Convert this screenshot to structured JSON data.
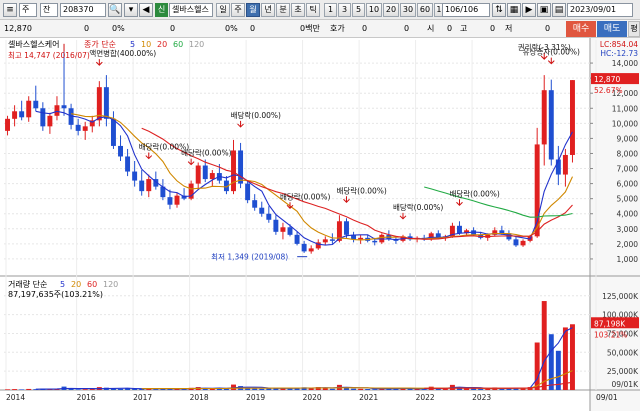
{
  "toolbar": {
    "market_toggle": "주",
    "search_toggle": "잔",
    "stock_code": "208370",
    "stock_badge": "신",
    "stock_name": "셀바스헬스",
    "period_buttons": [
      "일",
      "주",
      "월",
      "년",
      "분",
      "초",
      "틱"
    ],
    "selected_period": "월",
    "interval_buttons": [
      "1",
      "3",
      "5",
      "10",
      "20",
      "30",
      "60",
      "120"
    ],
    "range_display": "106/106",
    "date_display": "2023/09/01"
  },
  "quote_bar": {
    "price": "12,870",
    "change": "0",
    "change_pct": "0%",
    "v1": "0",
    "v2": "0%",
    "v3": "0",
    "vol_label": "0백만",
    "hoga_label": "호가",
    "h1": "0",
    "h2": "0",
    "si_label": "시",
    "si": "0",
    "go_label": "고",
    "go": "0",
    "jeo_label": "저",
    "jeo": "0",
    "buy_label": "매수",
    "sell_label": "매도",
    "eval_label": "평"
  },
  "price_panel": {
    "title": "셀바스헬스케어",
    "title2": "종가 단순",
    "ma_periods": [
      "5",
      "10",
      "20",
      "60",
      "120"
    ],
    "ma_colors": [
      "#2233cc",
      "#d08800",
      "#dd2222",
      "#22aa44",
      "#999999"
    ],
    "lc_label": "LC:854.04",
    "hc_label": "HC:-12.73",
    "high_annotation": "최고 14,747 (2016/07)",
    "low_annotation": "최저 1,349 (2019/08)",
    "price_tag": "12,870",
    "pct_tag": "52.67%",
    "y_ticks": [
      "14,000",
      "13,000",
      "12,000",
      "11,000",
      "10,000",
      "9,000",
      "8,000",
      "7,000",
      "6,000",
      "5,000",
      "4,000",
      "3,000",
      "2,000",
      "1,000"
    ],
    "events": [
      {
        "label": "액면병합(400.00%)"
      },
      {
        "label": "배당락(0.00%)"
      },
      {
        "label": "배당락(0.00%)"
      },
      {
        "label": "배당락(0.00%)"
      },
      {
        "label": "배당락(0.00%)"
      },
      {
        "label": "배당락(0.00%)"
      },
      {
        "label": "배당락(0.00%)"
      },
      {
        "label": "배당락(0.00%)"
      },
      {
        "label": "권리락(-3.31%)"
      },
      {
        "label": "유상증자(0.00%)"
      }
    ]
  },
  "volume_panel": {
    "title": "거래량 단순",
    "ma_periods": [
      "5",
      "20",
      "60",
      "120"
    ],
    "ma_colors": [
      "#2233cc",
      "#d08800",
      "#dd2222",
      "#999999"
    ],
    "volume_text": "87,197,635주(103.21%)",
    "y_ticks": [
      "125,000K",
      "100,000K",
      "75,000K",
      "50,000K",
      "25,000K"
    ],
    "unit_label": "09/01K",
    "volume_tag": "87,198K",
    "pct_tag": "103.21%"
  },
  "x_axis": [
    "2014",
    "2016",
    "2017",
    "2018",
    "2019",
    "2020",
    "2021",
    "2022",
    "2023",
    "09/01"
  ],
  "chart_data": [
    {
      "type": "candlestick",
      "title": "셀바스헬스케어",
      "ylim": [
        0,
        15000
      ],
      "highlights": {
        "high": 14747,
        "high_date": "2016/07",
        "low": 1349,
        "low_date": "2019/08",
        "last": 12870
      },
      "x_labels": [
        "2014",
        "2016",
        "2017",
        "2018",
        "2019",
        "2020",
        "2021",
        "2022",
        "2023"
      ],
      "candles": [
        [
          9500,
          10500,
          9200,
          10300
        ],
        [
          10300,
          11200,
          9800,
          10800
        ],
        [
          10800,
          11500,
          10200,
          10400
        ],
        [
          10400,
          11800,
          10100,
          11500
        ],
        [
          11500,
          12500,
          10800,
          11000
        ],
        [
          11000,
          11400,
          9500,
          9800
        ],
        [
          9800,
          10700,
          9300,
          10500
        ],
        [
          10500,
          11800,
          10200,
          11200
        ],
        [
          11200,
          14747,
          10500,
          11000
        ],
        [
          11000,
          11300,
          9600,
          9900
        ],
        [
          9900,
          10300,
          9200,
          9500
        ],
        [
          9500,
          10100,
          8900,
          9800
        ],
        [
          9800,
          10500,
          9400,
          10200
        ],
        [
          10200,
          12800,
          9800,
          12400
        ],
        [
          12400,
          13200,
          9800,
          10300
        ],
        [
          10300,
          10800,
          8300,
          8500
        ],
        [
          8500,
          9200,
          7500,
          7800
        ],
        [
          7800,
          8300,
          6500,
          6800
        ],
        [
          6800,
          7500,
          5800,
          6200
        ],
        [
          6200,
          6900,
          5200,
          5500
        ],
        [
          5500,
          6600,
          5100,
          6300
        ],
        [
          6300,
          6800,
          5600,
          5800
        ],
        [
          5800,
          6300,
          4900,
          5100
        ],
        [
          5100,
          5600,
          4300,
          4600
        ],
        [
          4600,
          5400,
          4400,
          5200
        ],
        [
          5200,
          5700,
          4900,
          5000
        ],
        [
          5000,
          6200,
          4900,
          6000
        ],
        [
          6000,
          7400,
          5600,
          7200
        ],
        [
          7200,
          7600,
          6100,
          6300
        ],
        [
          6300,
          6900,
          5800,
          6700
        ],
        [
          6700,
          7300,
          6000,
          6200
        ],
        [
          6200,
          6500,
          5300,
          5500
        ],
        [
          5500,
          8900,
          5300,
          8200
        ],
        [
          8200,
          8700,
          5700,
          6000
        ],
        [
          6000,
          6200,
          4700,
          4900
        ],
        [
          4900,
          5300,
          4200,
          4400
        ],
        [
          4400,
          4800,
          3800,
          4000
        ],
        [
          4000,
          4500,
          3400,
          3600
        ],
        [
          3600,
          3900,
          2600,
          2800
        ],
        [
          2800,
          3400,
          2300,
          3100
        ],
        [
          3100,
          3300,
          2500,
          2600
        ],
        [
          2600,
          2800,
          1900,
          2000
        ],
        [
          2000,
          2200,
          1400,
          1500
        ],
        [
          1500,
          1900,
          1349,
          1700
        ],
        [
          1700,
          2300,
          1600,
          2100
        ],
        [
          2100,
          2500,
          1900,
          2300
        ],
        [
          2300,
          2700,
          2000,
          2200
        ],
        [
          2200,
          3900,
          2100,
          3500
        ],
        [
          3500,
          3700,
          2400,
          2600
        ],
        [
          2600,
          2800,
          2100,
          2300
        ],
        [
          2300,
          2600,
          2000,
          2400
        ],
        [
          2400,
          2600,
          2100,
          2200
        ],
        [
          2200,
          2400,
          1900,
          2100
        ],
        [
          2100,
          2700,
          2000,
          2600
        ],
        [
          2600,
          2900,
          2200,
          2300
        ],
        [
          2300,
          2500,
          2000,
          2200
        ],
        [
          2200,
          2600,
          2100,
          2500
        ],
        [
          2500,
          2700,
          2200,
          2300
        ],
        [
          2300,
          2500,
          2100,
          2400
        ],
        [
          2400,
          2600,
          2200,
          2300
        ],
        [
          2300,
          2800,
          2200,
          2700
        ],
        [
          2700,
          2900,
          2300,
          2400
        ],
        [
          2400,
          2600,
          2200,
          2500
        ],
        [
          2500,
          3400,
          2400,
          3200
        ],
        [
          3200,
          3500,
          2600,
          2700
        ],
        [
          2700,
          3000,
          2500,
          2900
        ],
        [
          2900,
          3100,
          2500,
          2600
        ],
        [
          2600,
          2800,
          2300,
          2400
        ],
        [
          2400,
          2700,
          2200,
          2600
        ],
        [
          2600,
          3100,
          2500,
          2900
        ],
        [
          2900,
          3200,
          2600,
          2700
        ],
        [
          2700,
          2900,
          2200,
          2300
        ],
        [
          2300,
          2500,
          1800,
          1900
        ],
        [
          1900,
          2300,
          1800,
          2200
        ],
        [
          2200,
          2600,
          2100,
          2500
        ],
        [
          2500,
          9700,
          2400,
          8600
        ],
        [
          8600,
          13200,
          7200,
          12200
        ],
        [
          12200,
          12900,
          7200,
          7600
        ],
        [
          7600,
          8500,
          5900,
          6600
        ],
        [
          6600,
          8300,
          5800,
          7900
        ],
        [
          7900,
          12870,
          7400,
          12870
        ]
      ]
    },
    {
      "type": "bar",
      "title": "거래량",
      "ylim": [
        0,
        130000
      ],
      "last_volume": 87197635,
      "last_volume_pct": 103.21,
      "values": [
        900,
        1200,
        800,
        1400,
        1100,
        1900,
        1000,
        1700,
        4500,
        1500,
        900,
        1100,
        1200,
        3800,
        3100,
        1600,
        1500,
        2200,
        1800,
        1600,
        2600,
        1200,
        1800,
        1500,
        2000,
        1300,
        2900,
        3900,
        2000,
        1400,
        2100,
        1700,
        7200,
        5200,
        2300,
        1900,
        1600,
        2100,
        3300,
        2400,
        1800,
        2600,
        3500,
        2300,
        3900,
        2800,
        1600,
        6800,
        3000,
        1700,
        1500,
        1300,
        1100,
        2700,
        2200,
        1400,
        2300,
        1600,
        1400,
        1200,
        4400,
        2400,
        1800,
        6800,
        2900,
        2200,
        1900,
        1700,
        1500,
        3400,
        2000,
        1600,
        3200,
        2600,
        3900,
        63000,
        118000,
        74000,
        52000,
        83000,
        87198
      ]
    }
  ]
}
